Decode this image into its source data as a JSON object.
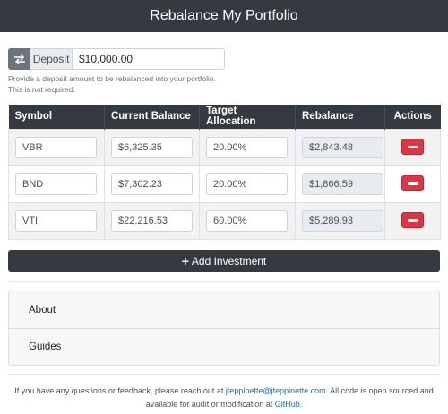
{
  "header": {
    "title": "Rebalance My Portfolio"
  },
  "deposit": {
    "toggle_icon": "swap-icon",
    "label": "Deposit",
    "value": "$10,000.00",
    "help_line1": "Provide a deposit amount to be rebalanced into your portfolio.",
    "help_line2": "This is not required."
  },
  "table": {
    "headers": [
      "Symbol",
      "Current Balance",
      "Target Allocation",
      "Rebalance",
      "Actions"
    ],
    "rows": [
      {
        "symbol": "VBR",
        "balance": "$6,325.35",
        "allocation": "20.00%",
        "rebalance": "$2,843.48"
      },
      {
        "symbol": "BND",
        "balance": "$7,302.23",
        "allocation": "20.00%",
        "rebalance": "$1,866.59"
      },
      {
        "symbol": "VTI",
        "balance": "$22,216.53",
        "allocation": "60.00%",
        "rebalance": "$5,289.93"
      }
    ]
  },
  "add_button": {
    "label": "Add Investment"
  },
  "accordion": {
    "items": [
      "About",
      "Guides"
    ]
  },
  "footer": {
    "text1": "If you have any questions or feedback, please reach out at ",
    "email": "jteppinette@jteppinette.com",
    "text2": ". All code is open sourced and available for audit or modification at ",
    "github": "GitHub",
    "text3": "."
  },
  "colors": {
    "navbar": "#343a40",
    "danger": "#dc3545",
    "link": "#0d6efd",
    "secondary": "#6c757d"
  }
}
